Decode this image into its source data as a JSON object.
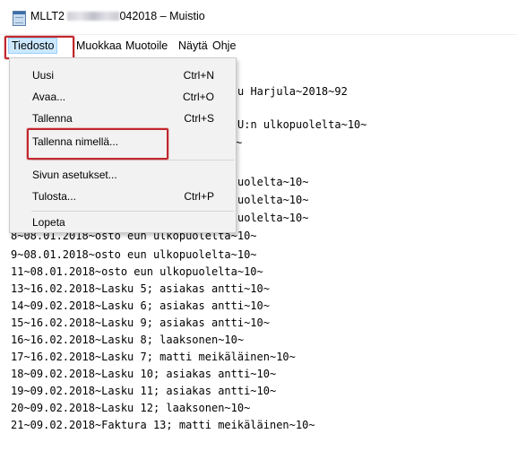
{
  "window": {
    "title_prefix": "MLLT2",
    "title_suffix": "042018 – Muistio"
  },
  "menubar": {
    "items": [
      "Tiedosto",
      "Muokkaa",
      "Muotoile",
      "Näytä",
      "Ohje"
    ]
  },
  "file_menu": {
    "items": [
      {
        "label": "Uusi",
        "shortcut": "Ctrl+N"
      },
      {
        "label": "Avaa...",
        "shortcut": "Ctrl+O"
      },
      {
        "label": "Tallenna",
        "shortcut": "Ctrl+S"
      },
      {
        "label": "Tallenna nimellä...",
        "shortcut": ""
      },
      {
        "label": "Sivun asetukset...",
        "shortcut": ""
      },
      {
        "label": "Tulosta...",
        "shortcut": "Ctrl+P"
      },
      {
        "label": "Lopeta",
        "shortcut": ""
      }
    ]
  },
  "editor": {
    "partial_lines": [
      "u Harjula~2018~92",
      "U:n ulkopuolelta~10~",
      "~",
      "uolelta~10~",
      "uolelta~10~",
      "uolelta~10~",
      "8~08.01.2018~osto eun ulkopuolelta~10~"
    ],
    "lines": [
      "9~08.01.2018~osto eun ulkopuolelta~10~",
      "11~08.01.2018~osto eun ulkopuolelta~10~",
      "13~16.02.2018~Lasku 5; asiakas antti~10~",
      "14~09.02.2018~Lasku 6; asiakas antti~10~",
      "15~16.02.2018~Lasku 9; asiakas antti~10~",
      "16~16.02.2018~Lasku 8; laaksonen~10~",
      "17~16.02.2018~Lasku 7; matti meikäläinen~10~",
      "18~09.02.2018~Lasku 10; asiakas antti~10~",
      "19~09.02.2018~Lasku 11; asiakas antti~10~",
      "20~09.02.2018~Lasku 12; laaksonen~10~",
      "21~09.02.2018~Faktura 13; matti meikäläinen~10~"
    ]
  },
  "colors": {
    "menu_active_bg": "#cce8ff",
    "highlight_border": "#c1272d",
    "dropdown_bg": "#f2f2f2"
  }
}
